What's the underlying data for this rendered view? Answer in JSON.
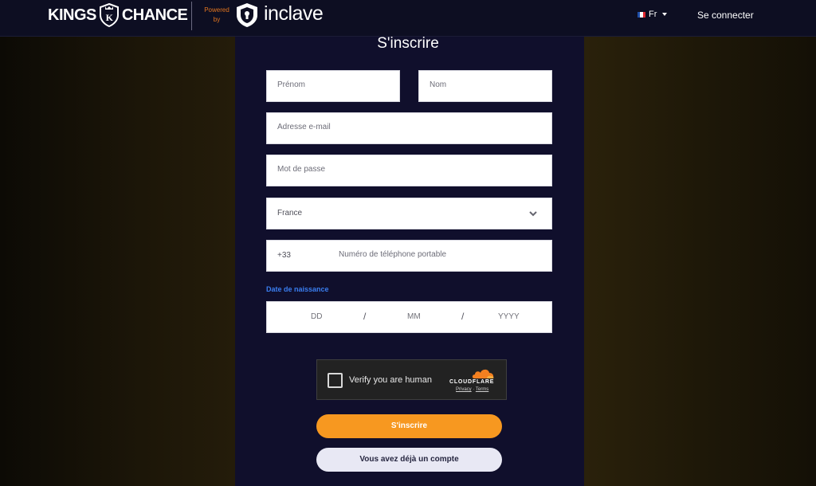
{
  "header": {
    "brand_left": "KINGS",
    "brand_mark": "K",
    "brand_right": "CHANCE",
    "powered_by": "Powered by",
    "partner_name": "inclave",
    "language": "Fr",
    "login_label": "Se connecter"
  },
  "form": {
    "title": "S'inscrire",
    "first_name_placeholder": "Prénom",
    "last_name_placeholder": "Nom",
    "email_placeholder": "Adresse e-mail",
    "password_placeholder": "Mot de passe",
    "country_value": "France",
    "phone_prefix": "+33",
    "phone_placeholder": "Numéro de téléphone portable",
    "dob_label": "Date de naissance",
    "dob_day": "DD",
    "dob_month": "MM",
    "dob_year": "YYYY",
    "dob_separator": "/"
  },
  "captcha": {
    "label": "Verify you are human",
    "provider": "CLOUDFLARE",
    "privacy": "Privacy",
    "separator": "·",
    "terms": "Terms"
  },
  "buttons": {
    "submit_label": "S'inscrire",
    "has_account_label": "Vous avez déjà un compte"
  },
  "colors": {
    "header_bg": "#0d0e22",
    "panel_bg": "#100f2c",
    "accent_orange": "#f79820",
    "dob_label_blue": "#3a7ef0"
  }
}
